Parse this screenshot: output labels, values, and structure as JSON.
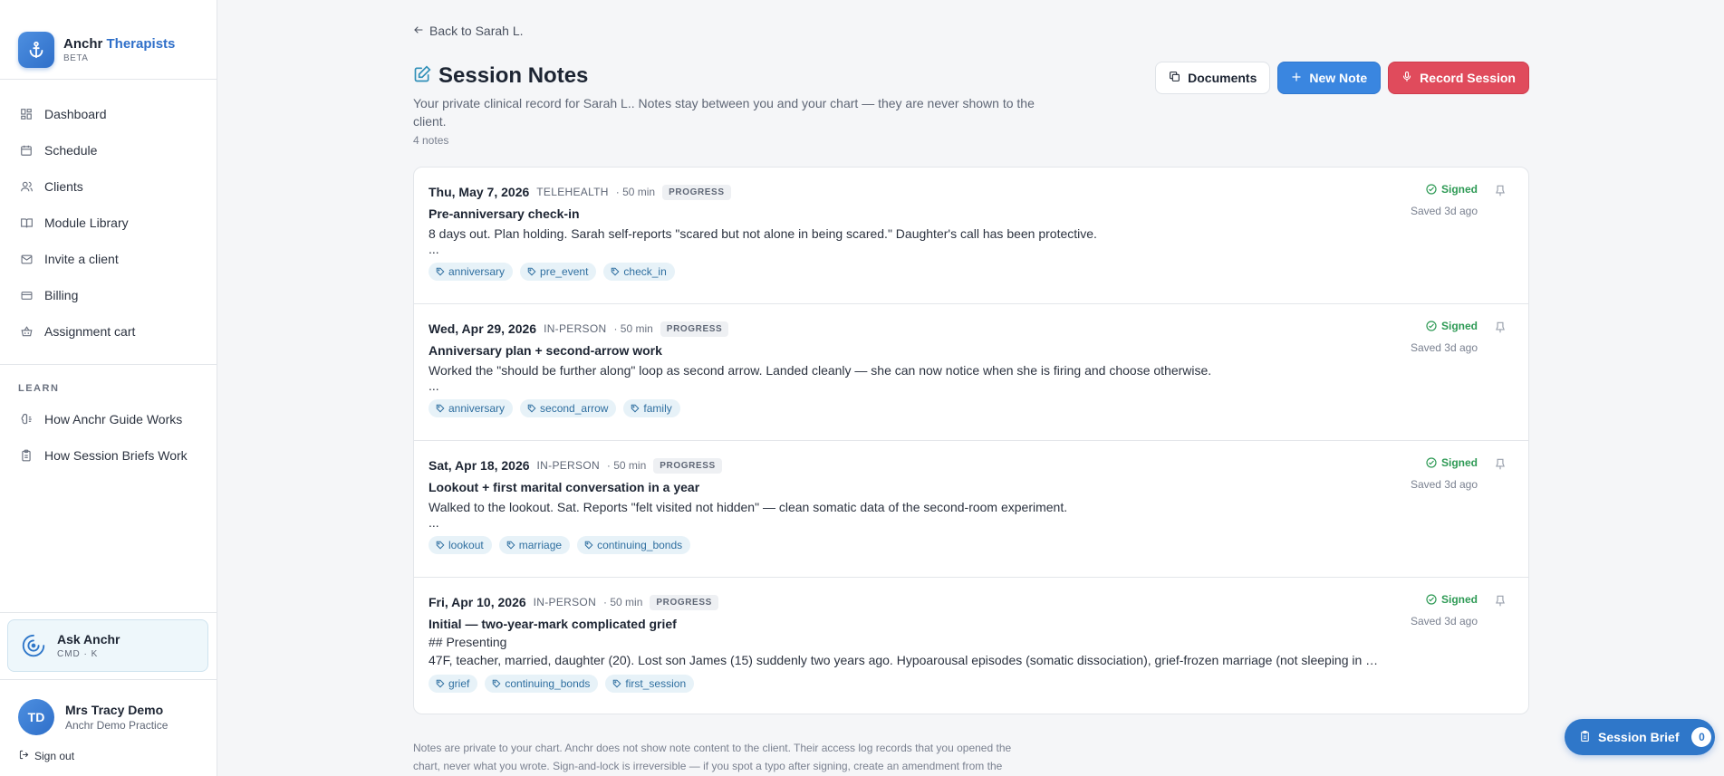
{
  "brand": {
    "name": "Anchr",
    "accent": "Therapists",
    "tag": "BETA"
  },
  "nav": {
    "items": [
      {
        "label": "Dashboard",
        "icon": "grid-icon"
      },
      {
        "label": "Schedule",
        "icon": "calendar-icon"
      },
      {
        "label": "Clients",
        "icon": "users-icon"
      },
      {
        "label": "Module Library",
        "icon": "book-icon"
      },
      {
        "label": "Invite a client",
        "icon": "mail-icon"
      },
      {
        "label": "Billing",
        "icon": "card-icon"
      },
      {
        "label": "Assignment cart",
        "icon": "basket-icon"
      }
    ],
    "learn_section": "LEARN",
    "learn_items": [
      {
        "label": "How Anchr Guide Works",
        "icon": "brain-icon"
      },
      {
        "label": "How Session Briefs Work",
        "icon": "clipboard-icon"
      }
    ]
  },
  "ask": {
    "title": "Ask Anchr",
    "shortcut": "CMD · K"
  },
  "user": {
    "initials": "TD",
    "name": "Mrs Tracy Demo",
    "org": "Anchr Demo Practice",
    "signout": "Sign out"
  },
  "page": {
    "back": "Back to Sarah L.",
    "title": "Session Notes",
    "subtitle": "Your private clinical record for Sarah L.. Notes stay between you and your chart — they are never shown to the client.",
    "count": "4 notes",
    "buttons": {
      "documents": "Documents",
      "new_note": "New Note",
      "record": "Record Session"
    },
    "footnote": "Notes are private to your chart. Anchr does not show note content to the client. Their access log records that you opened the chart, never what you wrote. Sign-and-lock is irreversible — if you spot a typo after signing, create an amendment from the"
  },
  "notes": [
    {
      "date": "Thu, May 7, 2026",
      "mode": "TELEHEALTH",
      "duration": "· 50 min",
      "type": "PROGRESS",
      "title": "Pre-anniversary check-in",
      "heading": "",
      "body": "8 days out. Plan holding. Sarah self-reports \"scared but not alone in being scared.\" Daughter's call has been protective.",
      "more": "...",
      "tags": [
        "anniversary",
        "pre_event",
        "check_in"
      ],
      "status": "Signed",
      "saved": "Saved 3d ago"
    },
    {
      "date": "Wed, Apr 29, 2026",
      "mode": "IN-PERSON",
      "duration": "· 50 min",
      "type": "PROGRESS",
      "title": "Anniversary plan + second-arrow work",
      "heading": "",
      "body": "Worked the \"should be further along\" loop as second arrow. Landed cleanly — she can now notice when she is firing and choose otherwise.",
      "more": "...",
      "tags": [
        "anniversary",
        "second_arrow",
        "family"
      ],
      "status": "Signed",
      "saved": "Saved 3d ago"
    },
    {
      "date": "Sat, Apr 18, 2026",
      "mode": "IN-PERSON",
      "duration": "· 50 min",
      "type": "PROGRESS",
      "title": "Lookout + first marital conversation in a year",
      "heading": "",
      "body": "Walked to the lookout. Sat. Reports \"felt visited not hidden\" — clean somatic data of the second-room experiment.",
      "more": "...",
      "tags": [
        "lookout",
        "marriage",
        "continuing_bonds"
      ],
      "status": "Signed",
      "saved": "Saved 3d ago"
    },
    {
      "date": "Fri, Apr 10, 2026",
      "mode": "IN-PERSON",
      "duration": "· 50 min",
      "type": "PROGRESS",
      "title": "Initial — two-year-mark complicated grief",
      "heading": "## Presenting",
      "body": "47F, teacher, married, daughter (20). Lost son James (15) suddenly two years ago. Hypoarousal episodes (somatic dissociation), grief-frozen marriage (not sleeping in …",
      "more": "",
      "tags": [
        "grief",
        "continuing_bonds",
        "first_session"
      ],
      "status": "Signed",
      "saved": "Saved 3d ago"
    }
  ],
  "brief": {
    "label": "Session Brief",
    "count": "0"
  },
  "colors": {
    "accent": "#3a86e0",
    "danger": "#e04b5c",
    "success": "#2e9a55"
  }
}
